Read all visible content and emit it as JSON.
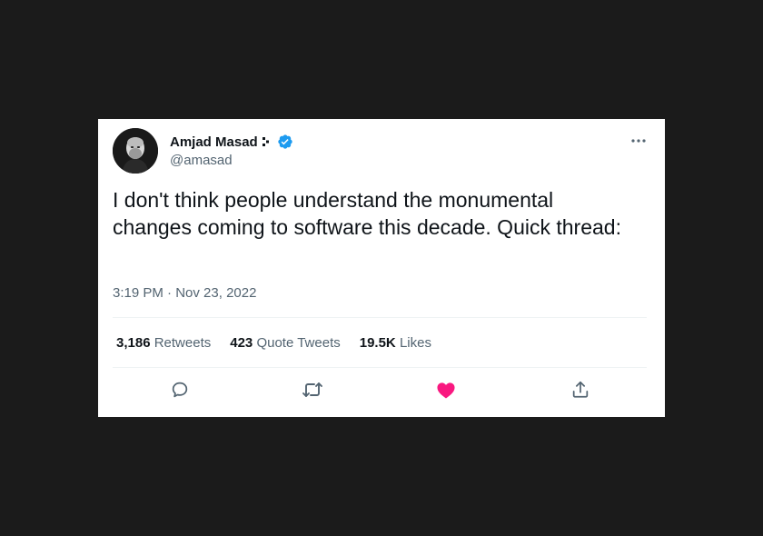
{
  "author": {
    "name": "Amjad Masad",
    "handle": "@amasad",
    "verified_color": "#1d9bf0"
  },
  "tweet": {
    "text": "I don't think people understand the monumental changes coming to software this decade. Quick thread:",
    "time": "3:19 PM",
    "separator": "·",
    "date": "Nov 23, 2022"
  },
  "stats": {
    "retweets_count": "3,186",
    "retweets_label": "Retweets",
    "quotes_count": "423",
    "quotes_label": "Quote Tweets",
    "likes_count": "19.5K",
    "likes_label": "Likes"
  },
  "actions": [
    {
      "icon": "reply-icon"
    },
    {
      "icon": "retweet-icon"
    },
    {
      "icon": "heart-icon",
      "color": "#f91880"
    },
    {
      "icon": "share-icon"
    }
  ],
  "icons": {
    "more": "more-options-icon",
    "name_glyph": "replit-logo-icon",
    "verified": "verified-badge-icon"
  }
}
